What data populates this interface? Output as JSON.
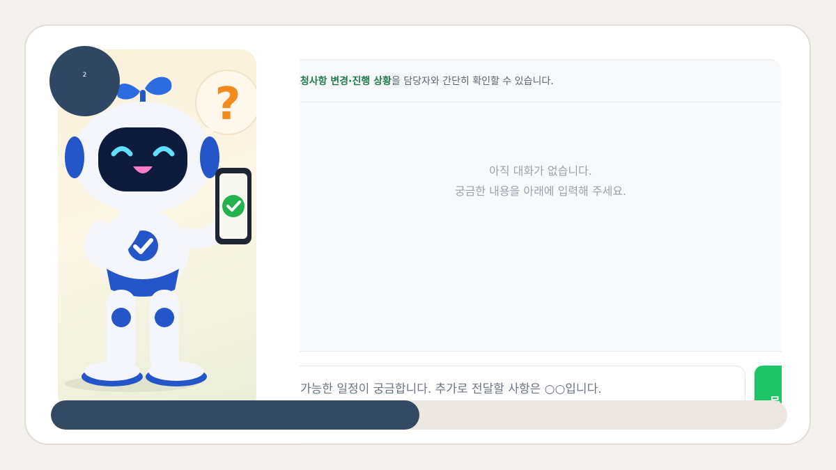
{
  "slide": {
    "step_number": "2"
  },
  "chat": {
    "header_highlight": "요청사항 변경·진행 상황",
    "header_text": "을 담당자와 간단히 확인할 수 있습니다.",
    "empty_line1": "아직 대화가 없습니다.",
    "empty_line2": "궁금한 내용을 아래에 입력해 주세요.",
    "input_value": "가능한 일정이 궁금합니다. 추가로 전달할 사항은 ○○입니다.",
    "send_label": "문"
  },
  "progress": {
    "fraction": 0.5
  },
  "colors": {
    "accent_green": "#1fc466",
    "highlight_green": "#1f7a4d",
    "navy": "#324863",
    "robot_blue": "#2456c9"
  },
  "icons": [
    "robot-mascot-icon",
    "question-mark-icon",
    "smartphone-icon",
    "checkmark-icon"
  ]
}
